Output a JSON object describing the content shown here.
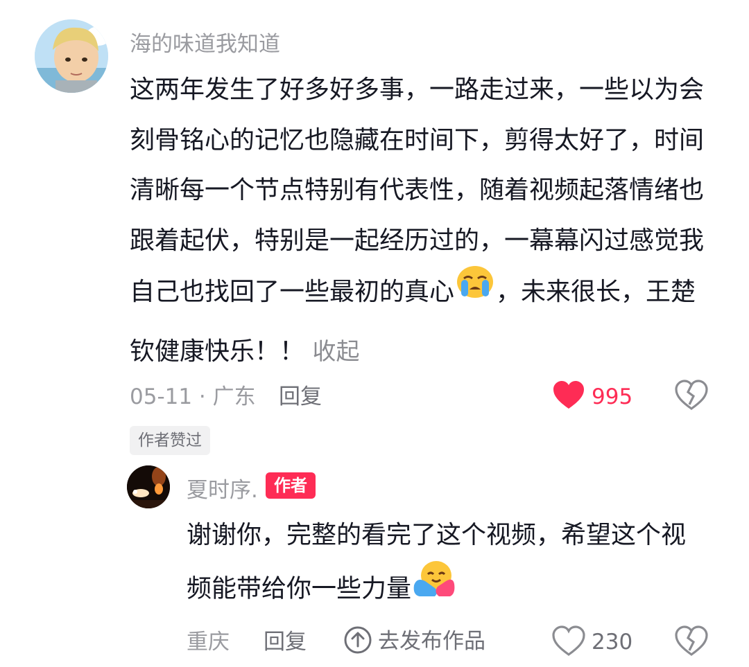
{
  "comment": {
    "username": "海的味道我知道",
    "lines": [
      "这两年发生了好多好多事，一路走过来，一些以为会",
      "刻骨铭心的记忆也隐藏在时间下，剪得太好了，时间",
      "清晰每一个节点特别有代表性，随着视频起落情绪也",
      "跟着起伏，特别是一起经历过的，一幕幕闪过感觉我"
    ],
    "line5_before_emoji": "自己也找回了一些最初的真心",
    "line5_after_emoji": "，未来很长，王楚",
    "line6": "钦健康快乐！！",
    "collapse_label": "收起",
    "date_location": "05-11 · 广东",
    "reply_label": "回复",
    "like_count": "995",
    "author_liked_tag": "作者赞过",
    "emoji": "loudly-crying-face"
  },
  "reply": {
    "username": "夏时序.",
    "author_badge": "作者",
    "line1": "谢谢你，完整的看完了这个视频，希望这个视",
    "line2_text": "频能带给你一些力量",
    "location": "重庆",
    "reply_label": "回复",
    "go_to_post_label": "去发布作品",
    "like_count": "230",
    "emoji": "hugging-face"
  },
  "colors": {
    "accent": "#fe2c55",
    "text": "#161823",
    "muted": "#9a9ba0"
  }
}
